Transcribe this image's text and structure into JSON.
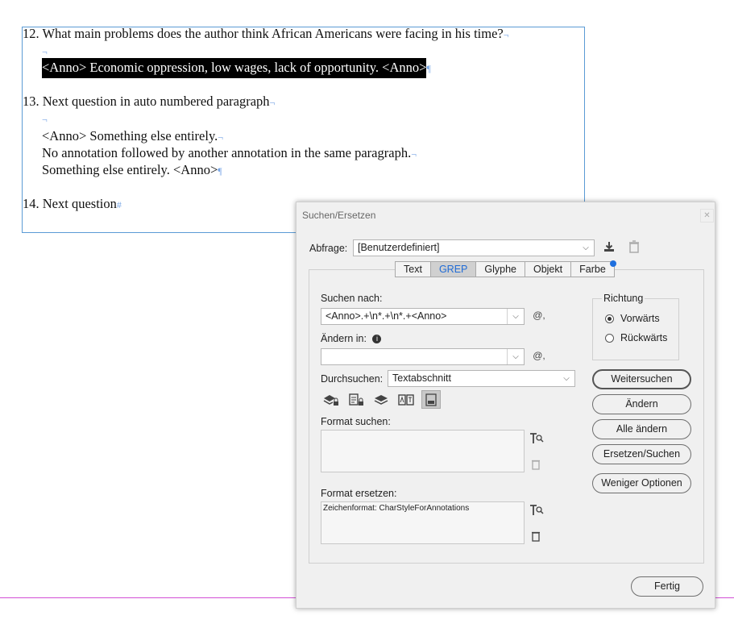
{
  "document": {
    "lines": [
      {
        "text": "12. What main problems does the author think African Americans were facing in his time?",
        "mark": "¬"
      },
      {
        "text": "",
        "mark": "¬"
      },
      {
        "text": "<Anno> Economic oppression, low wages, lack of opportunity. <Anno>",
        "mark": "¶",
        "selected": true
      },
      {
        "text": "13. Next question in auto numbered paragraph",
        "mark": "¬"
      },
      {
        "text": "",
        "mark": "¬"
      },
      {
        "text": "<Anno> Something else entirely.",
        "mark": "¬"
      },
      {
        "text": "No annotation followed by another annotation in the same paragraph.",
        "mark": "¬"
      },
      {
        "text": "Something else entirely. <Anno>",
        "mark": "¶"
      },
      {
        "text": "14. Next question",
        "mark": "#"
      }
    ]
  },
  "dialog": {
    "title": "Suchen/Ersetzen",
    "query_label": "Abfrage:",
    "query_value": "[Benutzerdefiniert]",
    "tabs": [
      "Text",
      "GREP",
      "Glyphe",
      "Objekt",
      "Farbe"
    ],
    "active_tab": "GREP",
    "search_label": "Suchen nach:",
    "search_value": "<Anno>.+\\n*.+\\n*.+<Anno>",
    "change_label": "Ändern in:",
    "change_value": "",
    "scope_label": "Durchsuchen:",
    "scope_value": "Textabschnitt",
    "direction_label": "Richtung",
    "direction_options": [
      "Vorwärts",
      "Rückwärts"
    ],
    "direction_selected": "Vorwärts",
    "find_format_label": "Format suchen:",
    "change_format_label": "Format ersetzen:",
    "change_format_value": "Zeichenformat: CharStyleForAnnotations",
    "buttons": {
      "find_next": "Weitersuchen",
      "change": "Ändern",
      "change_all": "Alle ändern",
      "change_find": "Ersetzen/Suchen",
      "fewer_options": "Weniger Optionen",
      "done": "Fertig"
    },
    "special_char_icon": "@,",
    "accent_color": "#1f6fde"
  }
}
